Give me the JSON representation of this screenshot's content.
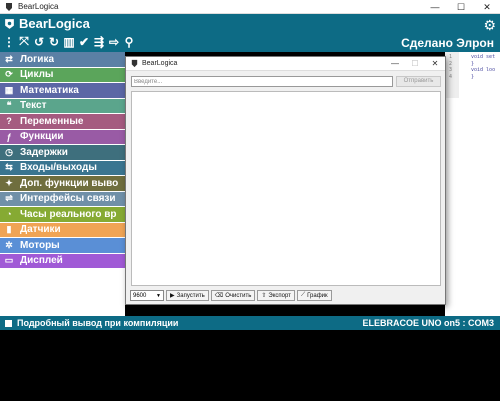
{
  "os_window": {
    "title": "BearLogica",
    "controls": {
      "minimize": "—",
      "maximize": "☐",
      "close": "✕"
    }
  },
  "appbar": {
    "title": "BearLogica",
    "made_by": "Сделано Элрон",
    "tools": [
      "more-vert-icon",
      "fullscreen-icon",
      "undo-icon",
      "redo-icon",
      "film-icon",
      "check-icon",
      "usb-icon",
      "export-icon",
      "search-icon"
    ]
  },
  "toolbox": {
    "categories": [
      {
        "label": "Логика",
        "color": "#5b80a5",
        "icon": "logic-icon"
      },
      {
        "label": "Циклы",
        "color": "#5ba55b",
        "icon": "loop-icon"
      },
      {
        "label": "Математика",
        "color": "#5b67a5",
        "icon": "math-icon"
      },
      {
        "label": "Текст",
        "color": "#5ba58c",
        "icon": "text-icon"
      },
      {
        "label": "Переменные",
        "color": "#a55b80",
        "icon": "variable-icon"
      },
      {
        "label": "Функции",
        "color": "#995ba5",
        "icon": "function-icon"
      },
      {
        "label": "Задержки",
        "color": "#3e6f7d",
        "icon": "timer-icon"
      },
      {
        "label": "Входы/выходы",
        "color": "#3a7590",
        "icon": "io-icon"
      },
      {
        "label": "Доп. функции выво",
        "color": "#6f6e3e",
        "icon": "wand-icon"
      },
      {
        "label": "Интерфейсы связи",
        "color": "#7090a8",
        "icon": "interface-icon"
      },
      {
        "label": "Часы реального вр",
        "color": "#86aa33",
        "icon": "clock-icon"
      },
      {
        "label": "Датчики",
        "color": "#f0a455",
        "icon": "sensor-icon"
      },
      {
        "label": "Моторы",
        "color": "#5a8fd6",
        "icon": "motor-icon"
      },
      {
        "label": "Дисплей",
        "color": "#a05ad6",
        "icon": "display-icon"
      }
    ]
  },
  "code": {
    "lines": [
      {
        "n": "1",
        "t": "void set"
      },
      {
        "n": "2",
        "t": "}"
      },
      {
        "n": "3",
        "t": "void loo"
      },
      {
        "n": "4",
        "t": "}"
      }
    ]
  },
  "statusbar": {
    "left": "Подробный вывод при компиляции",
    "right": "ELEBRACOE UNO on5 : COM3"
  },
  "serial": {
    "title": "BearLogica",
    "input_placeholder": "Введите...",
    "send_label": "Отправить",
    "baud": "9600",
    "buttons": [
      {
        "label": "Запустить",
        "icon": "play-icon"
      },
      {
        "label": "Очистить",
        "icon": "eraser-icon"
      },
      {
        "label": "Экспорт",
        "icon": "export-icon"
      },
      {
        "label": "График",
        "icon": "chart-icon"
      }
    ]
  }
}
